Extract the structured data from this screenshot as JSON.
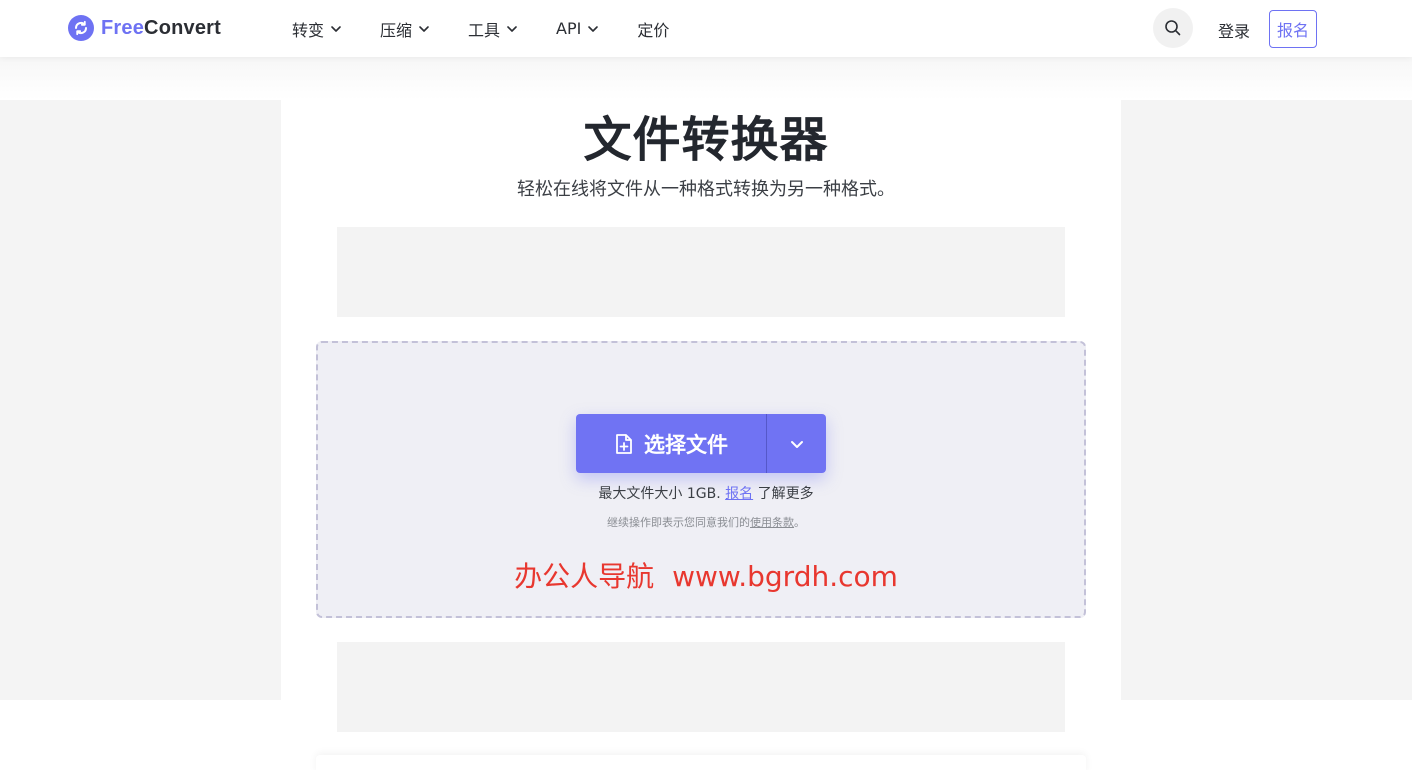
{
  "brand": {
    "name_part1": "Free",
    "name_part2": "Convert",
    "accent": "#6e72f3"
  },
  "nav": {
    "items": [
      {
        "label": "转变",
        "icon": "chevron-down-icon"
      },
      {
        "label": "压缩",
        "icon": "chevron-down-icon"
      },
      {
        "label": "工具",
        "icon": "chevron-down-icon"
      },
      {
        "label": "API",
        "icon": "chevron-down-icon"
      },
      {
        "label": "定价"
      }
    ],
    "search_icon": "search-icon",
    "login_label": "登录",
    "signup_label": "报名"
  },
  "hero": {
    "title": "文件转换器",
    "subtitle": "轻松在线将文件从一种格式转换为另一种格式。"
  },
  "upload": {
    "choose_label": "选择文件",
    "choose_icon": "file-plus-icon",
    "dropdown_icon": "chevron-down-icon",
    "max_size_text": "最大文件大小 1GB.",
    "signup_link": "报名",
    "learn_more_text": "了解更多",
    "terms_prefix": "继续操作即表示您同意我们的",
    "terms_link": "使用条款",
    "terms_suffix": "。"
  },
  "watermark": {
    "text1": "办公人导航",
    "text2": "www.bgrdh.com",
    "color": "#e8372f"
  }
}
